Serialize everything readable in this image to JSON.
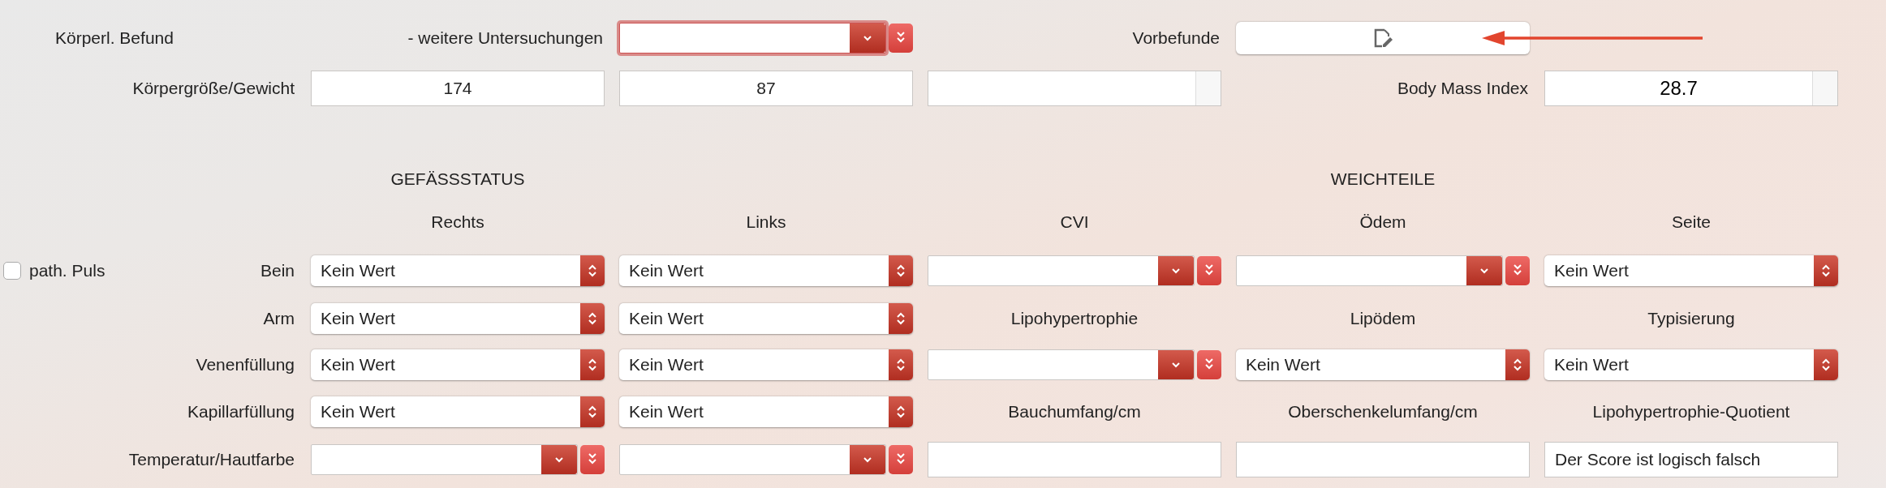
{
  "rows": [
    {
      "cells": [
        {
          "kind": "title",
          "text": "Körperl. Befund"
        },
        {
          "kind": "row_label",
          "text": "- weitere Untersuchungen"
        },
        {
          "kind": "combo",
          "focused": true
        },
        {
          "kind": "row_label",
          "text": "Vorbefunde"
        },
        {
          "kind": "icon_button"
        },
        null
      ]
    },
    {
      "cells": [
        {
          "kind": "row_label",
          "text": "Körpergröße/Gewicht"
        },
        {
          "kind": "field",
          "value": "174"
        },
        {
          "kind": "field",
          "value": "87"
        },
        {
          "kind": "field_split"
        },
        {
          "kind": "row_label",
          "text": "Body Mass Index"
        },
        {
          "kind": "field_split",
          "value": "28.7"
        }
      ]
    },
    {
      "cells": [
        null,
        {
          "kind": "heading",
          "text": "GEFÄSSSTATUS"
        },
        null,
        null,
        {
          "kind": "heading",
          "text": "WEICHTEILE"
        },
        null
      ]
    },
    {
      "cells": [
        null,
        {
          "kind": "caption",
          "text": "Rechts"
        },
        {
          "kind": "caption",
          "text": "Links"
        },
        {
          "kind": "caption",
          "text": "CVI"
        },
        {
          "kind": "caption",
          "text": "Ödem"
        },
        {
          "kind": "caption",
          "text": "Seite"
        }
      ]
    },
    {
      "cells": [
        {
          "kind": "check_label",
          "check_text": "path. Puls",
          "checked": false,
          "text": "Bein"
        },
        {
          "kind": "popup",
          "value": "Kein Wert"
        },
        {
          "kind": "popup",
          "value": "Kein Wert"
        },
        {
          "kind": "combo",
          "focused": false
        },
        {
          "kind": "combo",
          "focused": false
        },
        {
          "kind": "popup",
          "value": "Kein Wert"
        }
      ]
    },
    {
      "cells": [
        {
          "kind": "row_label",
          "text": "Arm"
        },
        {
          "kind": "popup",
          "value": "Kein Wert"
        },
        {
          "kind": "popup",
          "value": "Kein Wert"
        },
        {
          "kind": "caption",
          "text": "Lipohypertrophie"
        },
        {
          "kind": "caption",
          "text": "Lipödem"
        },
        {
          "kind": "caption",
          "text": "Typisierung"
        }
      ]
    },
    {
      "cells": [
        {
          "kind": "row_label",
          "text": "Venenfüllung"
        },
        {
          "kind": "popup",
          "value": "Kein Wert"
        },
        {
          "kind": "popup",
          "value": "Kein Wert"
        },
        {
          "kind": "combo",
          "focused": false
        },
        {
          "kind": "popup",
          "value": "Kein Wert"
        },
        {
          "kind": "popup",
          "value": "Kein Wert"
        }
      ]
    },
    {
      "cells": [
        {
          "kind": "row_label",
          "text": "Kapillarfüllung"
        },
        {
          "kind": "popup",
          "value": "Kein Wert"
        },
        {
          "kind": "popup",
          "value": "Kein Wert"
        },
        {
          "kind": "caption",
          "text": "Bauchumfang/cm"
        },
        {
          "kind": "caption",
          "text": "Oberschenkelumfang/cm"
        },
        {
          "kind": "caption",
          "text": "Lipohypertrophie-Quotient"
        }
      ]
    },
    {
      "cells": [
        {
          "kind": "row_label",
          "text": "Temperatur/Hautfarbe"
        },
        {
          "kind": "combo",
          "focused": false
        },
        {
          "kind": "combo",
          "focused": false
        },
        {
          "kind": "field"
        },
        {
          "kind": "field"
        },
        {
          "kind": "output",
          "value": "Der Score ist logisch falsch"
        }
      ]
    }
  ]
}
